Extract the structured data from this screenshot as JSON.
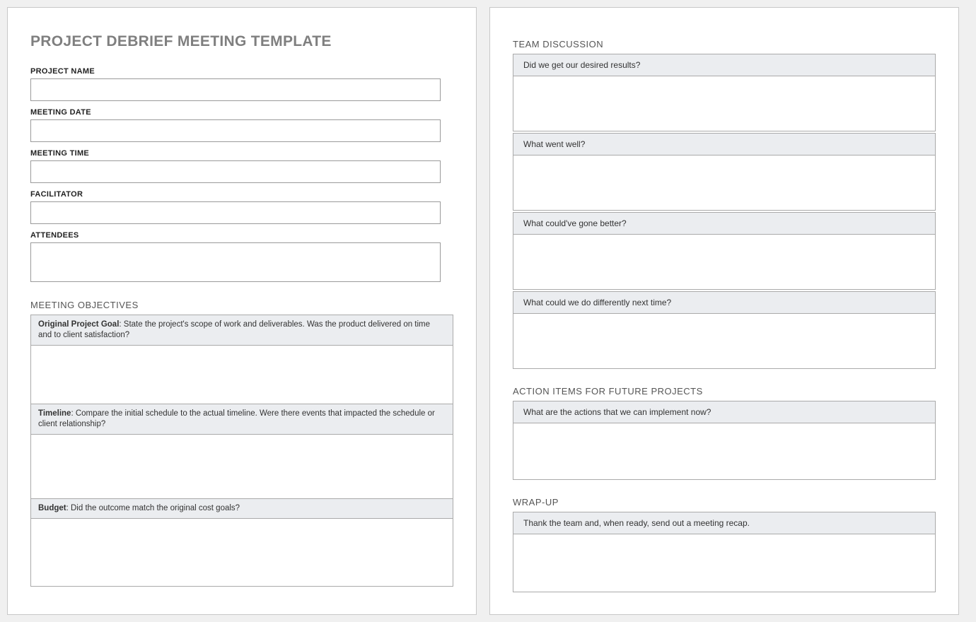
{
  "header": {
    "title": "PROJECT DEBRIEF MEETING TEMPLATE"
  },
  "fields": {
    "project_name_label": "PROJECT NAME",
    "project_name_value": "",
    "meeting_date_label": "MEETING DATE",
    "meeting_date_value": "",
    "meeting_time_label": "MEETING TIME",
    "meeting_time_value": "",
    "facilitator_label": "FACILITATOR",
    "facilitator_value": "",
    "attendees_label": "ATTENDEES",
    "attendees_value": ""
  },
  "meeting_objectives": {
    "heading": "MEETING OBJECTIVES",
    "goal_bold": "Original Project Goal",
    "goal_rest": ": State the project's scope of work and deliverables. Was the product delivered on time and to client satisfaction?",
    "goal_value": "",
    "timeline_bold": "Timeline",
    "timeline_rest": ": Compare the initial schedule to the actual timeline. Were there events that impacted the schedule or client relationship?",
    "timeline_value": "",
    "budget_bold": "Budget",
    "budget_rest": ": Did the outcome match the original cost goals?",
    "budget_value": ""
  },
  "team_discussion": {
    "heading": "TEAM DISCUSSION",
    "q1": "Did we get our desired results?",
    "q1_value": "",
    "q2": "What went well?",
    "q2_value": "",
    "q3": "What could've gone better?",
    "q3_value": "",
    "q4": "What could we do differently next time?",
    "q4_value": ""
  },
  "action_items": {
    "heading": "ACTION ITEMS FOR FUTURE PROJECTS",
    "q1": "What are the actions that we can implement now?",
    "q1_value": ""
  },
  "wrapup": {
    "heading": "WRAP-UP",
    "q1": "Thank the team and, when ready, send out a meeting recap.",
    "q1_value": ""
  }
}
